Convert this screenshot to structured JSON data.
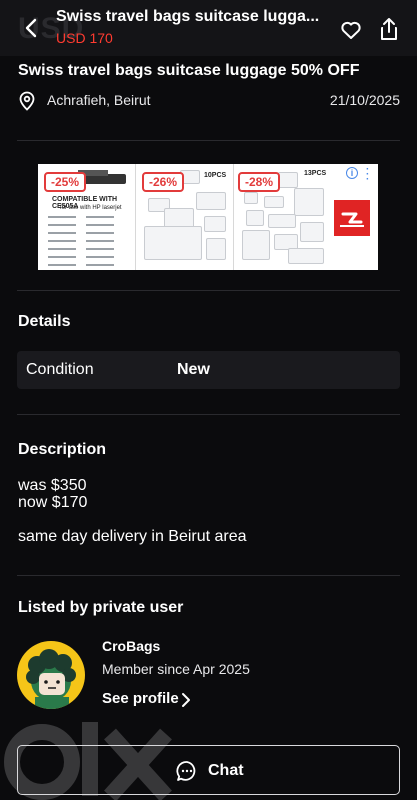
{
  "topbar": {
    "watermark": "USD",
    "title": "Swiss travel bags suitcase lugga...",
    "price": "USD 170",
    "back_icon": "back-arrow-icon",
    "favorite_icon": "heart-icon",
    "share_icon": "share-icon"
  },
  "listing": {
    "title": "Swiss travel bags suitcase luggage 50% OFF",
    "location": "Achrafieh, Beirut",
    "date": "21/10/2025",
    "location_icon": "map-pin-icon"
  },
  "ad": {
    "badges": [
      "-25%",
      "-26%",
      "-28%"
    ],
    "compatible_text": "COMPATIBLE WITH CE505A",
    "compatible_sub": "for use with HP laserjet",
    "label_10": "10PCS",
    "label_13": "13PCS",
    "info_glyph": "i",
    "logo_icon": "ad-logo-icon"
  },
  "details": {
    "title": "Details",
    "rows": [
      {
        "label": "Condition",
        "value": "New"
      }
    ]
  },
  "description": {
    "title": "Description",
    "line1": "was $350",
    "line2": "now $170",
    "line3": "same day delivery in Beirut area"
  },
  "seller": {
    "section_title": "Listed by private user",
    "name": "CroBags",
    "member_since": "Member since Apr 2025",
    "see_profile": "See profile"
  },
  "actions": {
    "chat_label": "Chat"
  },
  "colors": {
    "background": "#0b0b0d",
    "accent_price": "#ff3b30",
    "avatar": "#f5c518"
  }
}
